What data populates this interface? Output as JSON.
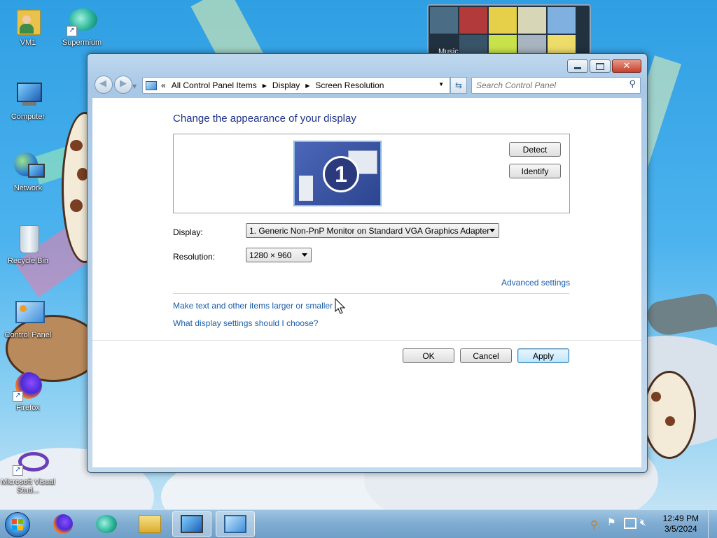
{
  "desktop": {
    "icons": [
      {
        "label": "VM1"
      },
      {
        "label": "Supermium"
      },
      {
        "label": "Computer"
      },
      {
        "label": "Network"
      },
      {
        "label": "Recycle Bin"
      },
      {
        "label": "Control Panel"
      },
      {
        "label": "Firefox"
      },
      {
        "label": "Microsoft Visual Stud..."
      }
    ],
    "media_widget_label": "Music"
  },
  "window": {
    "breadcrumb": [
      "All Control Panel Items",
      "Display",
      "Screen Resolution"
    ],
    "breadcrumb_prefix": "«",
    "search_placeholder": "Search Control Panel",
    "heading": "Change the appearance of your display",
    "monitor_number": "1",
    "detect_label": "Detect",
    "identify_label": "Identify",
    "display_label": "Display:",
    "display_value": "1. Generic Non-PnP Monitor on Standard VGA Graphics Adapter",
    "resolution_label": "Resolution:",
    "resolution_value": "1280 × 960",
    "advanced_settings": "Advanced settings",
    "link_larger_text": "Make text and other items larger or smaller",
    "link_display_help": "What display settings should I choose?",
    "ok_label": "OK",
    "cancel_label": "Cancel",
    "apply_label": "Apply"
  },
  "taskbar": {
    "time": "12:49 PM",
    "date": "3/5/2024",
    "pinned": [
      "start-orb",
      "firefox",
      "supermium",
      "file-explorer",
      "screen-resolution",
      "control-panel"
    ]
  },
  "colors": {
    "heading": "#1e3287",
    "link": "#1a5ea8",
    "monitor_bg": "#3f5aa8"
  }
}
